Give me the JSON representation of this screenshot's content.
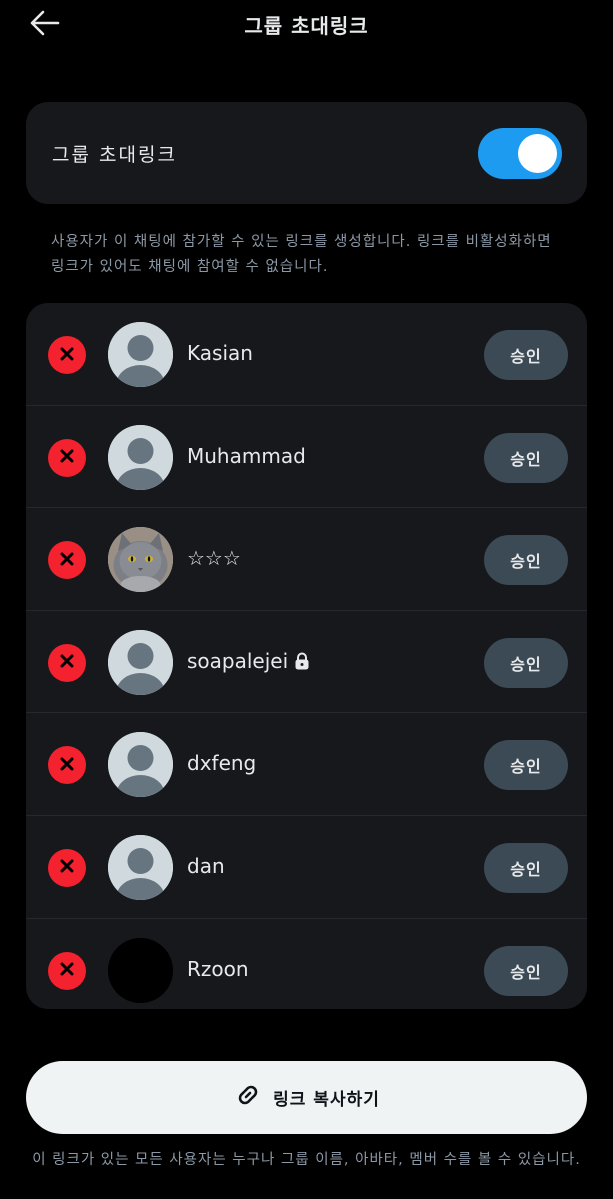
{
  "header": {
    "title": "그룹 초대링크",
    "back_icon": "arrow-left-icon"
  },
  "invite_toggle": {
    "label": "그룹 초대링크",
    "enabled": true,
    "color": "#1d9bf0"
  },
  "description": "사용자가 이 채팅에 참가할 수 있는 링크를 생성합니다. 링크를 비활성화하면 링크가 있어도 채팅에 참여할 수 없습니다.",
  "requests": [
    {
      "name": "Kasian",
      "avatar": "default-avatar",
      "locked": false,
      "approve_label": "승인"
    },
    {
      "name": "Muhammad",
      "avatar": "default-avatar",
      "locked": false,
      "approve_label": "승인"
    },
    {
      "name": "☆☆☆",
      "avatar": "cat-photo-avatar",
      "locked": false,
      "approve_label": "승인"
    },
    {
      "name": "soapalejei",
      "avatar": "default-avatar",
      "locked": true,
      "approve_label": "승인"
    },
    {
      "name": "dxfeng",
      "avatar": "default-avatar",
      "locked": false,
      "approve_label": "승인"
    },
    {
      "name": "dan",
      "avatar": "default-avatar",
      "locked": false,
      "approve_label": "승인"
    },
    {
      "name": "Rzoon",
      "avatar": "black-avatar",
      "locked": false,
      "approve_label": "승인"
    }
  ],
  "copy_button": {
    "label": "링크 복사하기",
    "icon": "link-icon"
  },
  "footer_note": "이 링크가 있는 모든 사용자는 누구나 그룹 이름, 아바타, 멤버 수를 볼 수 있습니다.",
  "colors": {
    "reject": "#f4212e",
    "approve_bg": "#3c4a55",
    "card_bg": "#16181c"
  }
}
